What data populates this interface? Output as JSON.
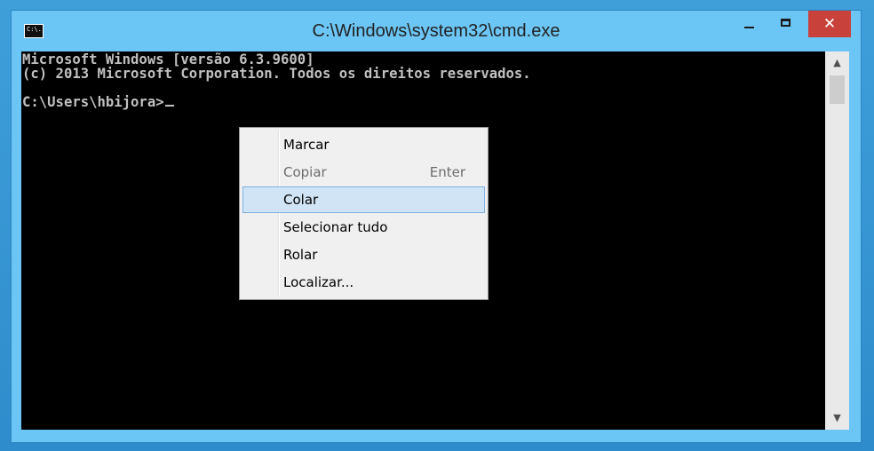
{
  "window": {
    "title": "C:\\Windows\\system32\\cmd.exe",
    "icon": "cmd-icon",
    "icon_text": "C:\\.",
    "buttons": {
      "minimize": "minimize-icon",
      "maximize": "maximize-icon",
      "close": "✕"
    }
  },
  "console": {
    "lines": [
      "Microsoft Windows [versão 6.3.9600]",
      "(c) 2013 Microsoft Corporation. Todos os direitos reservados.",
      "",
      "C:\\Users\\hbijora>"
    ]
  },
  "scrollbar": {
    "up": "▲",
    "down": "▼"
  },
  "context_menu": {
    "items": [
      {
        "label": "Marcar",
        "shortcut": "",
        "enabled": true
      },
      {
        "label": "Copiar",
        "shortcut": "Enter",
        "enabled": false
      },
      {
        "label": "Colar",
        "shortcut": "",
        "enabled": true,
        "highlighted": true
      },
      {
        "label": "Selecionar tudo",
        "shortcut": "",
        "enabled": true
      },
      {
        "label": "Rolar",
        "shortcut": "",
        "enabled": true
      },
      {
        "label": "Localizar...",
        "shortcut": "",
        "enabled": true
      }
    ]
  },
  "colors": {
    "desktop": "#3c9bd6",
    "window_frame": "#6cc6f5",
    "close_button": "#c8413a",
    "console_bg": "#000000",
    "console_text": "#c0c0c0",
    "menu_highlight": "#d1e4f5"
  }
}
